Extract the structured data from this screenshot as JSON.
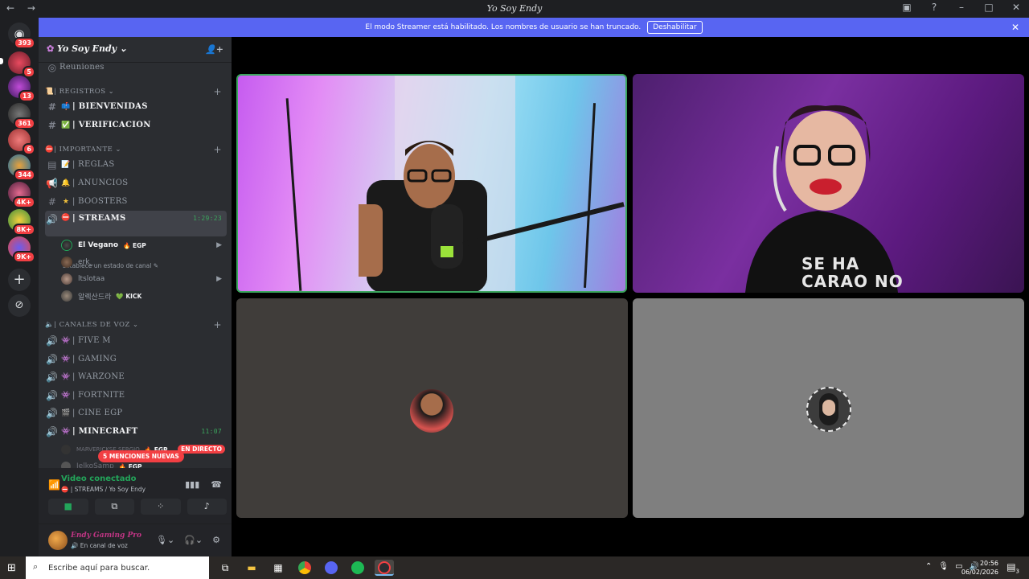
{
  "window": {
    "title": "Yo Soy Endy",
    "nav": "← →",
    "icons": [
      "inbox-icon",
      "help-icon",
      "minimize-icon",
      "maximize-icon",
      "close-icon"
    ]
  },
  "servers": [
    {
      "badge": "393"
    },
    {
      "badge": "5"
    },
    {
      "badge": "13"
    },
    {
      "badge": "361"
    },
    {
      "badge": "6"
    },
    {
      "badge": "344"
    },
    {
      "badge": "4K+"
    },
    {
      "badge": "8K+"
    },
    {
      "badge": "9K+"
    }
  ],
  "banner": {
    "text": "El modo Streamer está habilitado. Los nombres de usuario se han truncado.",
    "button": "Deshabilitar",
    "close": "✕"
  },
  "guild": {
    "name": "Yo Soy Endy",
    "chevron": "⌄"
  },
  "channels": {
    "reuniones": "Reuniones",
    "cat_registros": "| REGISTROS",
    "bienvenidas": "| BIENVENIDAS",
    "verificacion": "| VERIFICACION",
    "cat_importante": "| IMPORTANTE",
    "reglas": "| REGLAS",
    "anuncios": "| ANUNCIOS",
    "boosters": "| BOOSTERS",
    "streams": "| STREAMS",
    "streams_time": "1:29:23",
    "streams_status": "Establece un estado de canal",
    "cat_voz": "| CANALES DE VOZ",
    "fivem": "| FIVE M",
    "gaming": "|  GAMING",
    "warzone": "| WARZONE",
    "fortnite": "| FORTNITE",
    "cine": "| CINE EGP",
    "minecraft": "| MINECRAFT",
    "minecraft_time": "11:07"
  },
  "voice_users": [
    {
      "name": "El Vegano",
      "tag": "EGP"
    },
    {
      "name": "erk_",
      "tag": ""
    },
    {
      "name": "ltslotaa",
      "tag": ""
    },
    {
      "name": "알렉산드라",
      "tag": "KICK"
    }
  ],
  "minecraft_users": [
    {
      "name": "MARVERICKSE SERGIO",
      "tag": "EGP"
    },
    {
      "name": "JelkoSamp",
      "tag": "EGP"
    }
  ],
  "live_badge": "EN DIRECTO",
  "mentions_pill": "5 MENCIONES NUEVAS",
  "voice_panel": {
    "title": "Video conectado",
    "subtitle": "| STREAMS / Yo Soy Endy"
  },
  "user": {
    "name": "Endy Gaming Pro",
    "status": "En canal de voz"
  },
  "stream_tiles": {
    "shirt_text": "SE HA\nCARAO NO"
  },
  "taskbar": {
    "search_placeholder": "Escribe aquí para buscar.",
    "time": "20:56",
    "date": "06/02/2026",
    "notif_count": "3"
  },
  "colors": {
    "accent": "#5865f2",
    "online": "#23a55a",
    "danger": "#f23f43",
    "speaking": "#3ba55d"
  }
}
